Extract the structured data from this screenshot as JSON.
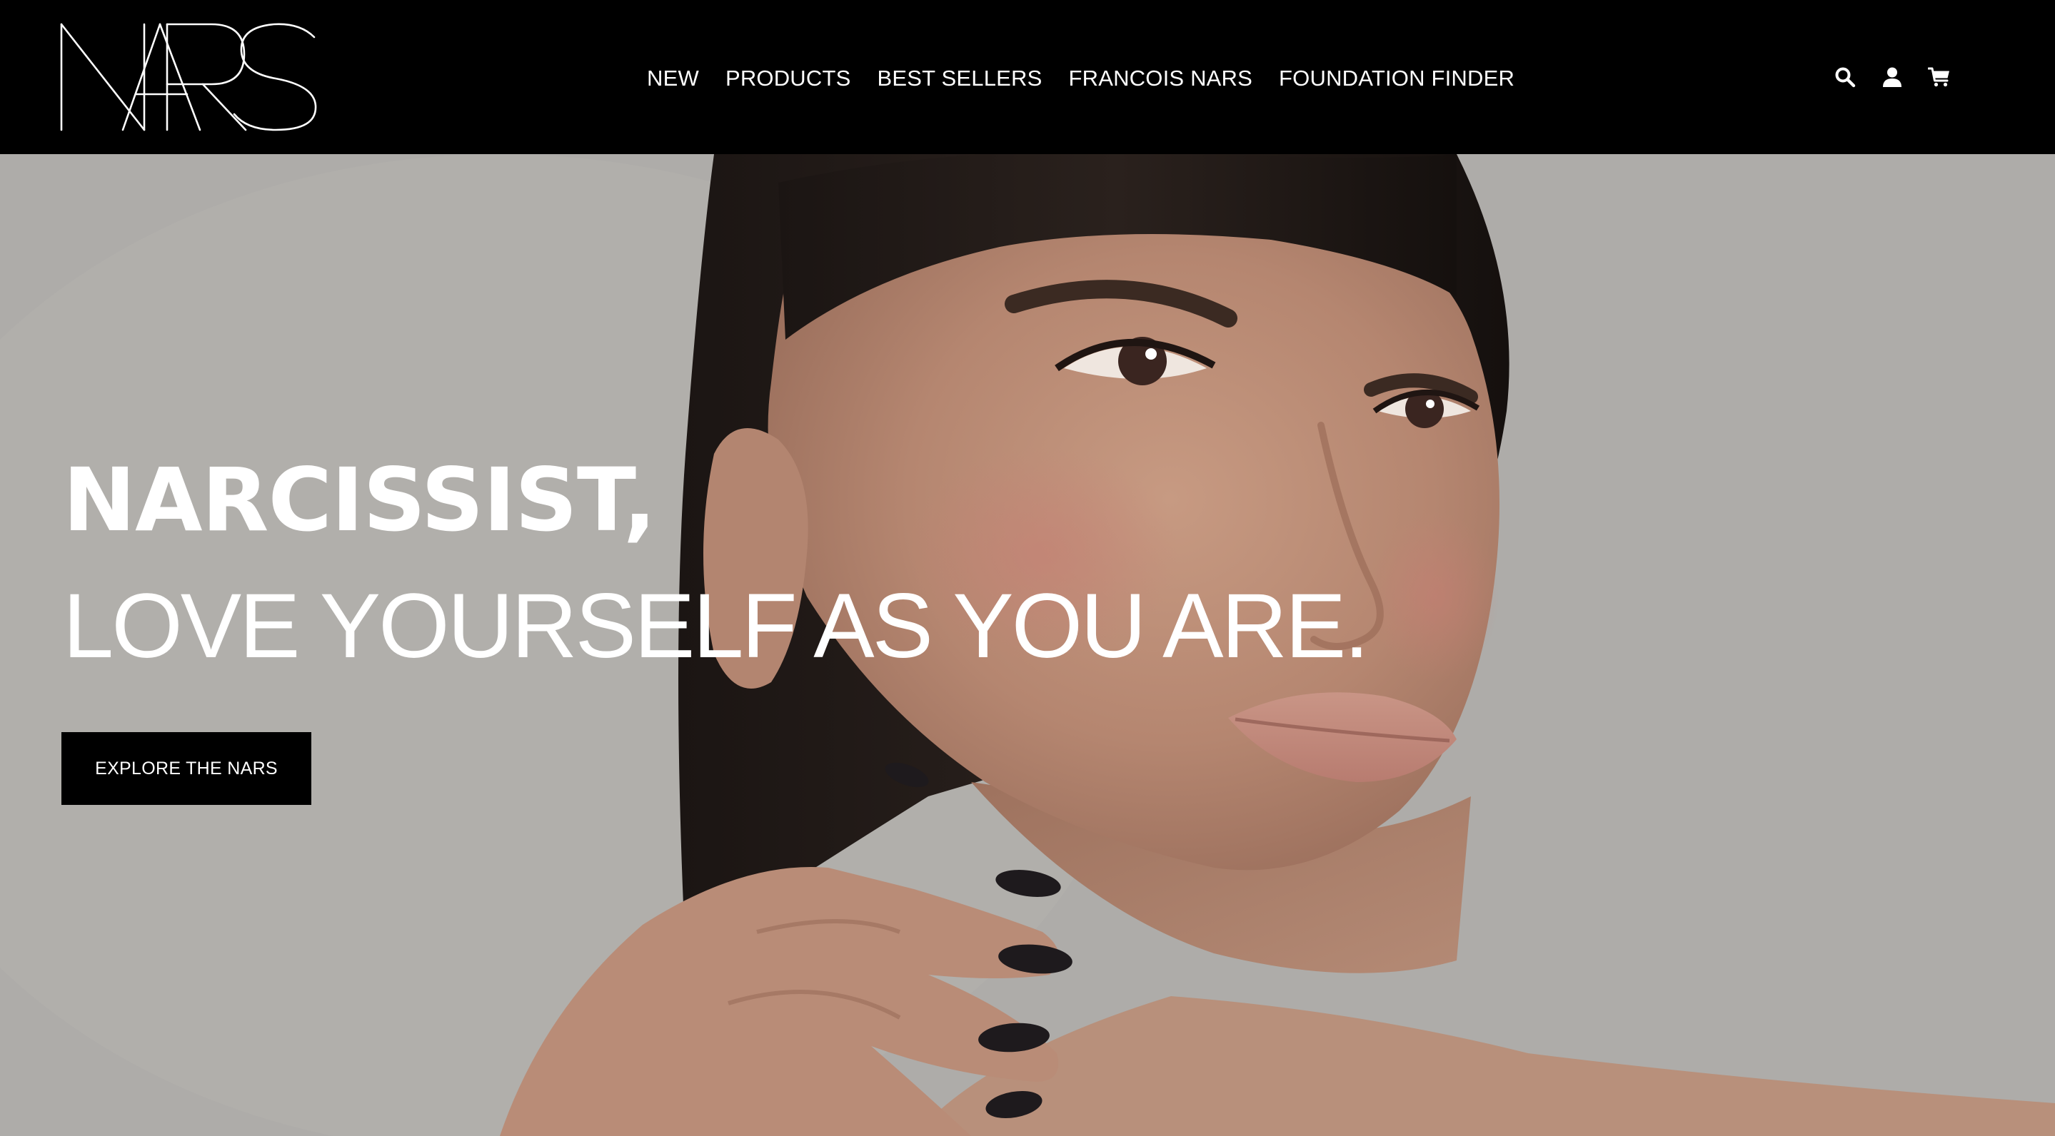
{
  "brand": {
    "logo_text": "NARS"
  },
  "nav": {
    "items": [
      {
        "label": "NEW"
      },
      {
        "label": "PRODUCTS"
      },
      {
        "label": "BEST SELLERS"
      },
      {
        "label": "FRANCOIS NARS"
      },
      {
        "label": "FOUNDATION FINDER"
      }
    ]
  },
  "utility": {
    "icons": [
      "search-icon",
      "account-icon",
      "cart-icon"
    ]
  },
  "hero": {
    "headline": "NARCISSIST,",
    "subheadline": "LOVE YOURSELF AS YOU ARE.",
    "cta_label": "EXPLORE THE NARS"
  },
  "colors": {
    "header_bg": "#000000",
    "text_light": "#ffffff",
    "button_bg": "#000000",
    "hero_bg": "#aeaca9"
  }
}
